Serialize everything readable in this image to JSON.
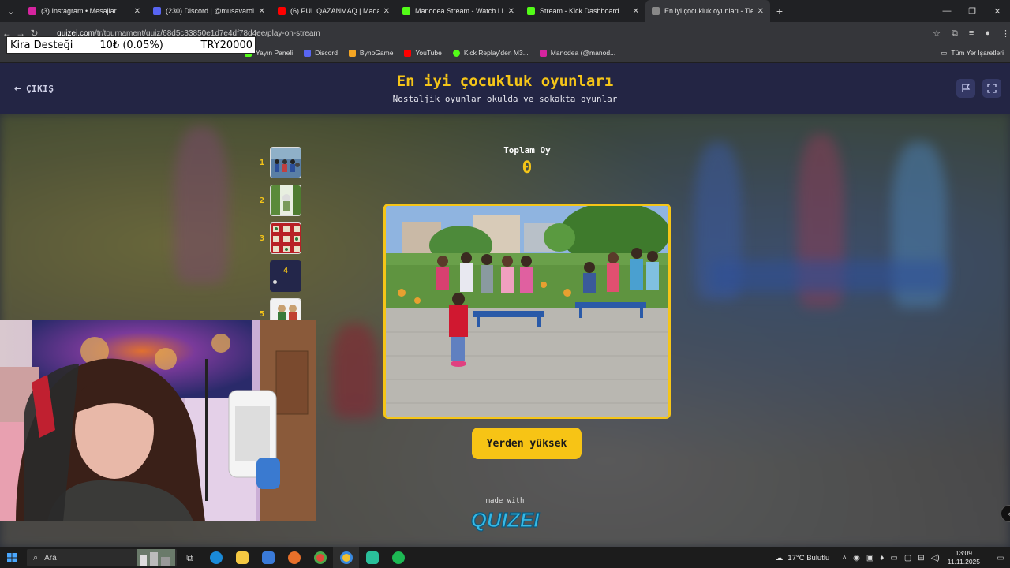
{
  "browser": {
    "tabs": [
      {
        "label": "(3) Instagram • Mesajlar",
        "color": "#d6249f",
        "active": false
      },
      {
        "label": "(230) Discord | @musavarol",
        "color": "#5865f2",
        "active": false
      },
      {
        "label": "(6) PUL QAZANMAQ | Madara",
        "color": "#ff0000",
        "active": false
      },
      {
        "label": "Manodea Stream - Watch Live",
        "color": "#53fc18",
        "active": false
      },
      {
        "label": "Stream - Kick Dashboard",
        "color": "#53fc18",
        "active": false
      },
      {
        "label": "En iyi çocukluk oyunları - Tier L",
        "color": "#888888",
        "active": true
      }
    ],
    "url_domain": "quizei.com",
    "url_path": "/tr/tournament/quiz/68d5c33850e1d7e4df78d4ee/play-on-stream",
    "bookmarks": [
      {
        "label": "Yayın Paneli",
        "color": "#53fc18"
      },
      {
        "label": "Discord",
        "color": "#5865f2"
      },
      {
        "label": "BynoGame",
        "color": "#f5a623"
      },
      {
        "label": "YouTube",
        "color": "#ff0000"
      },
      {
        "label": "Kick Replay'den M3...",
        "color": "#53fc18"
      },
      {
        "label": "Manodea (@manod...",
        "color": "#d6249f"
      }
    ],
    "all_bookmarks": "Tüm Yer İşaretleri"
  },
  "donation": {
    "label": "Kira Desteği",
    "amount": "10₺ (0.05%)",
    "goal": "TRY20000"
  },
  "quiz": {
    "exit_label": "ÇIKIŞ",
    "title": "En iyi çocukluk oyunları",
    "subtitle": "Nostaljik oyunlar okulda ve sokakta oyunlar",
    "total_label": "Toplam Oy",
    "total_value": "0",
    "ranks": [
      {
        "num": "1",
        "filled": true
      },
      {
        "num": "2",
        "filled": true
      },
      {
        "num": "3",
        "filled": true
      },
      {
        "num": "4",
        "filled": false
      },
      {
        "num": "5",
        "filled": true
      }
    ],
    "choice_label": "Yerden yüksek",
    "made_with": "made with",
    "brand": "QUIZEI"
  },
  "taskbar": {
    "search_placeholder": "Ara",
    "weather": "17°C  Bulutlu",
    "time": "13:09",
    "date": "11.11.2025"
  }
}
